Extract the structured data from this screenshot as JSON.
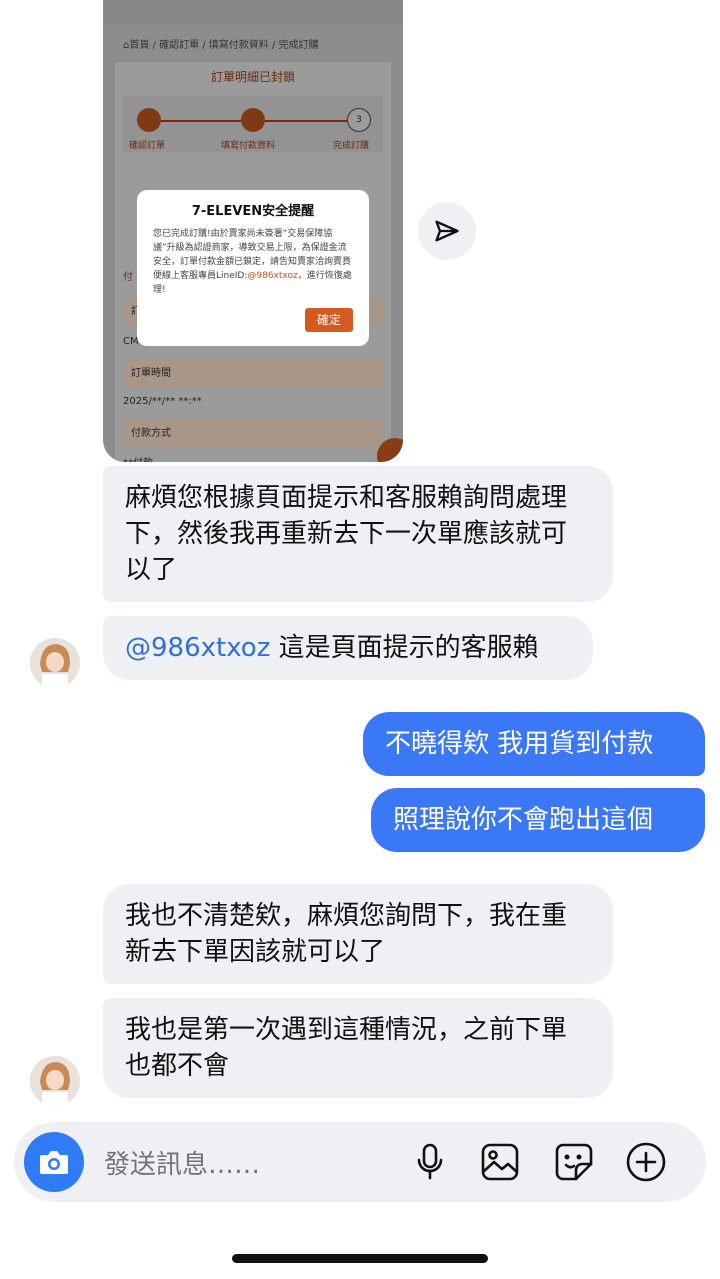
{
  "shared_image": {
    "breadcrumb": "⌂首頁 / 確認訂單 / 填寫付款資料 / 完成訂購",
    "panel_title": "訂單明細已封鎖",
    "steps": [
      "確認訂單",
      "填寫付款資料",
      "完成訂購"
    ],
    "step3_number": "3",
    "partial_tab": "付",
    "row_label_1": "訂",
    "row_value_1": "CM",
    "row_label_2": "訂單時間",
    "row_value_2": "2025/**/**    **:**",
    "row_label_3": "付款方式",
    "row_value_3": "**付款",
    "dialog": {
      "title": "7-ELEVEN安全提醒",
      "body": "您已完成訂購!由於賣家尚未簽署“交易保障協議”升級為認證商家，導致交易上限，為保證金流安全，訂單付款金額已鎖定，請告知賣家洽詢賣貨便線上客服專員LineID:",
      "link": "@986xtxoz",
      "body_end": "，進行恢復處理!",
      "ok_label": "確定"
    }
  },
  "messages": [
    {
      "side": "in",
      "text": "麻煩您根據頁面提示和客服賴詢問處理下，然後我再重新去下一次單應該就可以了"
    },
    {
      "side": "in",
      "mention": "@986xtxoz",
      "text": " 這是頁面提示的客服賴"
    },
    {
      "side": "out",
      "text": "不曉得欸 我用貨到付款"
    },
    {
      "side": "out",
      "text": "照理說你不會跑出這個"
    },
    {
      "side": "in",
      "text": "我也不清楚欸，麻煩您詢問下，我在重新去下單因該就可以了"
    },
    {
      "side": "in",
      "text": "我也是第一次遇到這種情況，之前下單也都不會"
    }
  ],
  "composer": {
    "placeholder": "發送訊息……"
  },
  "colors": {
    "outgoing_bubble": "#3b78f6",
    "incoming_bubble": "#eef0f3",
    "accent": "#2f7cf6"
  }
}
